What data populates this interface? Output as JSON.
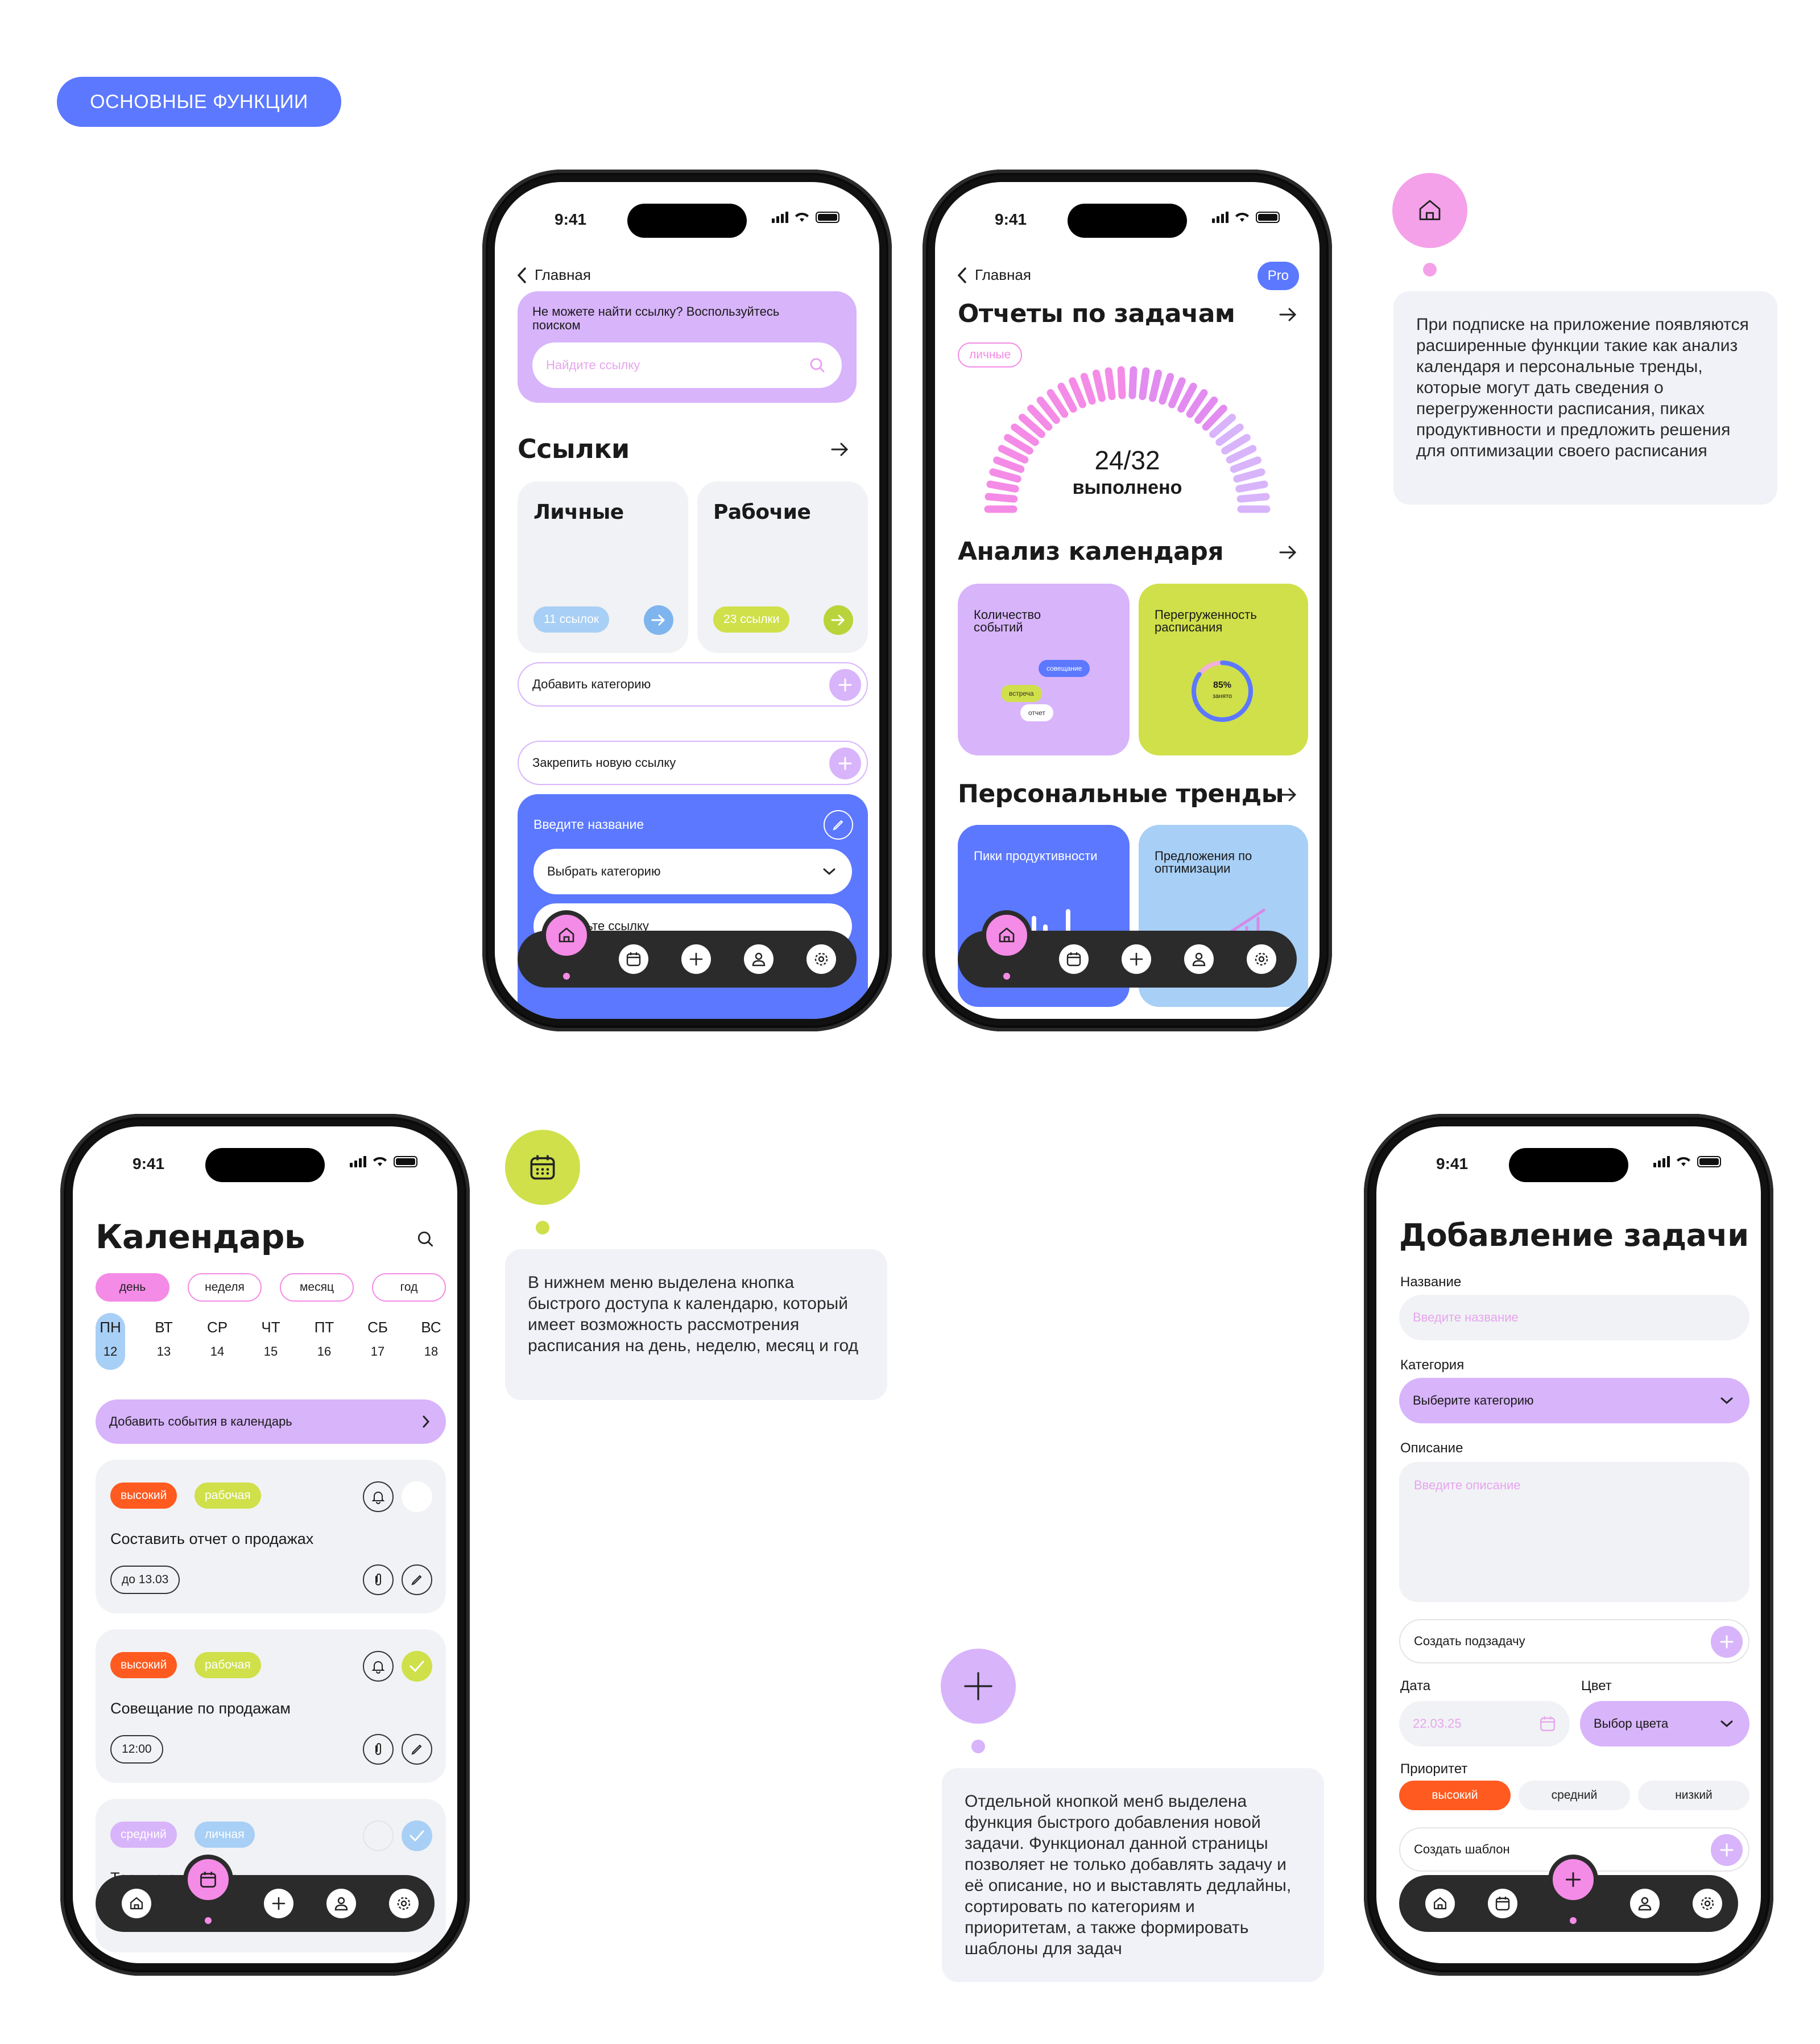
{
  "header": {
    "badge": "ОСНОВНЫЕ ФУНКЦИИ"
  },
  "colors": {
    "accent_blue": "#5b78ff",
    "accent_purple": "#d8b4fb",
    "accent_pink": "#f48be6",
    "accent_lime": "#cfe04a",
    "accent_light_blue": "#a8cff5",
    "accent_orange": "#ff5a1f",
    "nav_dark": "#2b2b2b"
  },
  "status": {
    "time": "9:41"
  },
  "links_screen": {
    "back_label": "Главная",
    "search_hint": "Не можете найти ссылку? Воспользуйтесь поиском",
    "search_placeholder": "Найдите ссылку",
    "section_title": "Ссылки",
    "cards": [
      {
        "title": "Личные",
        "count": "11 ссылок"
      },
      {
        "title": "Рабочие",
        "count": "23 ссылки"
      }
    ],
    "add_category": "Добавить категорию",
    "pin_link": "Закрепить новую ссылку",
    "form_title": "Введите название",
    "form_select": "Выбрать категорию",
    "form_link": "Вставьте ссылку"
  },
  "reports_screen": {
    "back_label": "Главная",
    "pro_badge": "Pro",
    "title": "Отчеты по задачам",
    "tag": "личные",
    "progress": {
      "done": 24,
      "total": 32,
      "value": "24/32",
      "label": "выполнено"
    },
    "calendar_title": "Анализ календаря",
    "events_card": {
      "title": "Количество событий",
      "chips": [
        "совещание",
        "встреча",
        "отчет"
      ]
    },
    "overload_card": {
      "title": "Перегруженность расписания",
      "percent": "85%",
      "percent_label": "занято",
      "fraction": 0.85
    },
    "trends_title": "Персональные тренды",
    "peaks_card": "Пики продуктивности",
    "optimize_card": "Предложения по оптимизации"
  },
  "calendar_screen": {
    "title": "Календарь",
    "views": [
      "день",
      "неделя",
      "месяц",
      "год"
    ],
    "days": [
      {
        "name": "ПН",
        "num": "12"
      },
      {
        "name": "ВТ",
        "num": "13"
      },
      {
        "name": "СР",
        "num": "14"
      },
      {
        "name": "ЧТ",
        "num": "15"
      },
      {
        "name": "ПТ",
        "num": "16"
      },
      {
        "name": "СБ",
        "num": "17"
      },
      {
        "name": "ВС",
        "num": "18"
      }
    ],
    "add_events": "Добавить события в календарь",
    "tasks": [
      {
        "priority": "высокий",
        "category": "рабочая",
        "title": "Составить отчет о продажах",
        "meta": "до 13.03",
        "done": false
      },
      {
        "priority": "высокий",
        "category": "рабочая",
        "title": "Совещание по продажам",
        "meta": "12:00",
        "done": true
      },
      {
        "priority": "средний",
        "category": "личная",
        "title": "Тест по английскому",
        "meta": "",
        "done": true
      }
    ]
  },
  "add_task_screen": {
    "title": "Добавление задачи",
    "name_label": "Название",
    "name_placeholder": "Введите название",
    "category_label": "Категория",
    "category_select": "Выберите категорию",
    "desc_label": "Описание",
    "desc_placeholder": "Введите описание",
    "subtask": "Создать подзадачу",
    "date_label": "Дата",
    "date_value": "22.03.25",
    "color_label": "Цвет",
    "color_select": "Выбор цвета",
    "priority_label": "Приоритет",
    "priorities": [
      "высокий",
      "средний",
      "низкий"
    ],
    "template": "Создать шаблон"
  },
  "callouts": {
    "pro": "При подписке на приложение появляются расширенные функции такие как анализ календаря и персональные тренды, которые могут дать сведения о перегруженности расписания, пиках продуктивности и предложить решения для оптимизации своего расписания",
    "calendar": "В нижнем меню выделена кнопка быстрого доступа к календарю, который имеет возможность рассмотрения расписания на день, неделю, месяц и год",
    "add": "Отдельной кнопкой менб выделена функция быстрого добавления новой задачи. Функционал данной страницы позволяет не только добавлять задачу и её описание, но и выставлять дедлайны, сортировать по категориям и приоритетам, а также формировать шаблоны для задач"
  }
}
